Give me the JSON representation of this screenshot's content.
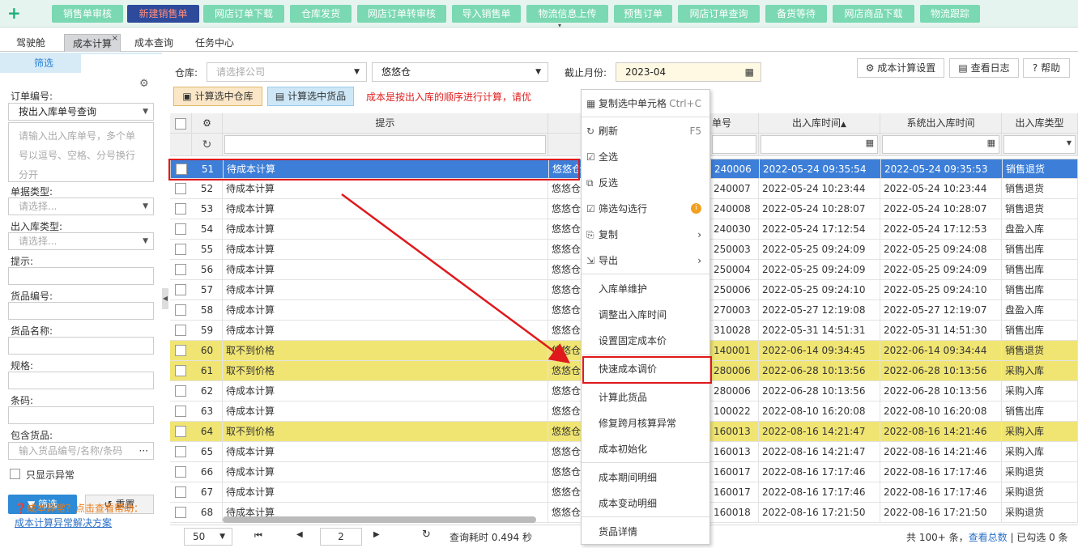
{
  "toolbar": {
    "buttons": [
      "销售单审核",
      "新建销售单",
      "网店订单下载",
      "仓库发货",
      "网店订单转审核",
      "导入销售单",
      "物流信息上传",
      "预售订单",
      "网店订单查询",
      "备货等待",
      "网店商品下载",
      "物流跟踪"
    ],
    "active_index": 1
  },
  "tabs": [
    {
      "label": "驾驶舱"
    },
    {
      "label": "成本计算",
      "active": true,
      "close": "×"
    },
    {
      "label": "成本查询"
    },
    {
      "label": "任务中心"
    }
  ],
  "sidebar": {
    "title": "筛选",
    "order_no_label": "订单编号:",
    "order_query_mode": "按出入库单号查询",
    "order_no_placeholder": "请输入出入库单号，多个单号以逗号、空格、分号换行分开",
    "doc_type_label": "单据类型:",
    "doc_type_placeholder": "请选择...",
    "io_type_label": "出入库类型:",
    "io_type_placeholder": "请选择...",
    "hint_label": "提示:",
    "goods_no_label": "货品编号:",
    "goods_name_label": "货品名称:",
    "spec_label": "规格:",
    "barcode_label": "条码:",
    "include_goods_label": "包含货品:",
    "include_goods_placeholder": "输入货品编号/名称/条码",
    "include_goods_more": "···",
    "only_abnormal_label": "只显示异常",
    "filter_button": "筛选",
    "reset_button": "重置",
    "warning_text": "成本异常？点击查看帮助：",
    "solution_link": "成本计算异常解决方案"
  },
  "filters": {
    "warehouse_label": "仓库:",
    "company_placeholder": "请选择公司",
    "warehouse_value": "悠悠仓",
    "month_label": "截止月份:",
    "month_value": "2023-04",
    "settings_button": "成本计算设置",
    "log_button": "查看日志",
    "help_button": "帮助",
    "calc_warehouse_button": "计算选中仓库",
    "calc_goods_button": "计算选中货品",
    "notice": "成本是按出入库的顺序进行计算，请优"
  },
  "grid": {
    "columns": {
      "hint": "提示",
      "doc_no": "单号",
      "io_time": "出入库时间",
      "sort_icon": "▲",
      "sys_io_time": "系统出入库时间",
      "io_type": "出入库类型"
    },
    "rows": [
      {
        "n": "51",
        "hint": "待成本计算",
        "wh": "悠悠仓",
        "no": "240006",
        "t": "2022-05-24 09:35:54",
        "st": "2022-05-24 09:35:53",
        "type": "销售退货",
        "style": "sel"
      },
      {
        "n": "52",
        "hint": "待成本计算",
        "wh": "悠悠仓",
        "no": "240007",
        "t": "2022-05-24 10:23:44",
        "st": "2022-05-24 10:23:44",
        "type": "销售退货",
        "style": ""
      },
      {
        "n": "53",
        "hint": "待成本计算",
        "wh": "悠悠仓",
        "no": "240008",
        "t": "2022-05-24 10:28:07",
        "st": "2022-05-24 10:28:07",
        "type": "销售退货",
        "style": ""
      },
      {
        "n": "54",
        "hint": "待成本计算",
        "wh": "悠悠仓",
        "no": "240030",
        "t": "2022-05-24 17:12:54",
        "st": "2022-05-24 17:12:53",
        "type": "盘盈入库",
        "style": ""
      },
      {
        "n": "55",
        "hint": "待成本计算",
        "wh": "悠悠仓",
        "no": "250003",
        "t": "2022-05-25 09:24:09",
        "st": "2022-05-25 09:24:08",
        "type": "销售出库",
        "style": ""
      },
      {
        "n": "56",
        "hint": "待成本计算",
        "wh": "悠悠仓",
        "no": "250004",
        "t": "2022-05-25 09:24:09",
        "st": "2022-05-25 09:24:09",
        "type": "销售出库",
        "style": ""
      },
      {
        "n": "57",
        "hint": "待成本计算",
        "wh": "悠悠仓",
        "no": "250006",
        "t": "2022-05-25 09:24:10",
        "st": "2022-05-25 09:24:10",
        "type": "销售出库",
        "style": ""
      },
      {
        "n": "58",
        "hint": "待成本计算",
        "wh": "悠悠仓",
        "no": "270003",
        "t": "2022-05-27 12:19:08",
        "st": "2022-05-27 12:19:07",
        "type": "盘盈入库",
        "style": ""
      },
      {
        "n": "59",
        "hint": "待成本计算",
        "wh": "悠悠仓",
        "no": "310028",
        "t": "2022-05-31 14:51:31",
        "st": "2022-05-31 14:51:30",
        "type": "销售出库",
        "style": ""
      },
      {
        "n": "60",
        "hint": "取不到价格",
        "wh": "悠悠仓",
        "no": "140001",
        "t": "2022-06-14 09:34:45",
        "st": "2022-06-14 09:34:44",
        "type": "销售退货",
        "style": "y"
      },
      {
        "n": "61",
        "hint": "取不到价格",
        "wh": "悠悠仓",
        "no": "280006",
        "t": "2022-06-28 10:13:56",
        "st": "2022-06-28 10:13:56",
        "type": "采购入库",
        "style": "y"
      },
      {
        "n": "62",
        "hint": "待成本计算",
        "wh": "悠悠仓",
        "no": "280006",
        "t": "2022-06-28 10:13:56",
        "st": "2022-06-28 10:13:56",
        "type": "采购入库",
        "style": ""
      },
      {
        "n": "63",
        "hint": "待成本计算",
        "wh": "悠悠仓",
        "no": "100022",
        "t": "2022-08-10 16:20:08",
        "st": "2022-08-10 16:20:08",
        "type": "销售出库",
        "style": ""
      },
      {
        "n": "64",
        "hint": "取不到价格",
        "wh": "悠悠仓",
        "no": "160013",
        "t": "2022-08-16 14:21:47",
        "st": "2022-08-16 14:21:46",
        "type": "采购入库",
        "style": "y"
      },
      {
        "n": "65",
        "hint": "待成本计算",
        "wh": "悠悠仓",
        "no": "160013",
        "t": "2022-08-16 14:21:47",
        "st": "2022-08-16 14:21:46",
        "type": "采购入库",
        "style": ""
      },
      {
        "n": "66",
        "hint": "待成本计算",
        "wh": "悠悠仓",
        "no": "160017",
        "t": "2022-08-16 17:17:46",
        "st": "2022-08-16 17:17:46",
        "type": "采购退货",
        "style": ""
      },
      {
        "n": "67",
        "hint": "待成本计算",
        "wh": "悠悠仓",
        "no": "160017",
        "t": "2022-08-16 17:17:46",
        "st": "2022-08-16 17:17:46",
        "type": "采购退货",
        "style": ""
      },
      {
        "n": "68",
        "hint": "待成本计算",
        "wh": "悠悠仓",
        "no": "160018",
        "t": "2022-08-16 17:21:50",
        "st": "2022-08-16 17:21:50",
        "type": "采购退货",
        "style": ""
      }
    ]
  },
  "pager": {
    "page_size": "50",
    "page": "2",
    "query_time": "查询耗时 0.494 秒",
    "total": "共 100+ 条，",
    "total_link": "查看总数",
    "selected": "| 已勾选 0 条"
  },
  "context_menu": {
    "items": [
      {
        "label": "复制选中单元格",
        "shortcut": "Ctrl+C",
        "icon": "grid-icon",
        "sym": "▦"
      },
      {
        "label": "刷新",
        "shortcut": "F5",
        "icon": "refresh-icon",
        "sym": "↻"
      },
      {
        "label": "全选",
        "icon": "check-all-icon",
        "sym": "☑"
      },
      {
        "label": "反选",
        "icon": "invert-icon",
        "sym": "⧉"
      },
      {
        "label": "筛选勾选行",
        "icon": "checkbox-icon",
        "sym": "☑",
        "badge": "i"
      },
      {
        "label": "复制",
        "icon": "copy-icon",
        "sym": "⎘",
        "sub": "›"
      },
      {
        "label": "导出",
        "icon": "export-icon",
        "sym": "⇲",
        "sub": "›"
      },
      {
        "label": "入库单维护"
      },
      {
        "label": "调整出入库时间"
      },
      {
        "label": "设置固定成本价"
      },
      {
        "label": "快速成本调价",
        "highlight": true
      },
      {
        "label": "计算此货品"
      },
      {
        "label": "修复跨月核算异常"
      },
      {
        "label": "成本初始化"
      },
      {
        "label": "成本期间明细"
      },
      {
        "label": "成本变动明细"
      },
      {
        "label": "货品详情"
      }
    ]
  },
  "colors": {
    "accent": "#7ad8b2",
    "selected": "#3d7fd8",
    "warning_row": "#f0e573",
    "annotation": "#e0191c"
  }
}
